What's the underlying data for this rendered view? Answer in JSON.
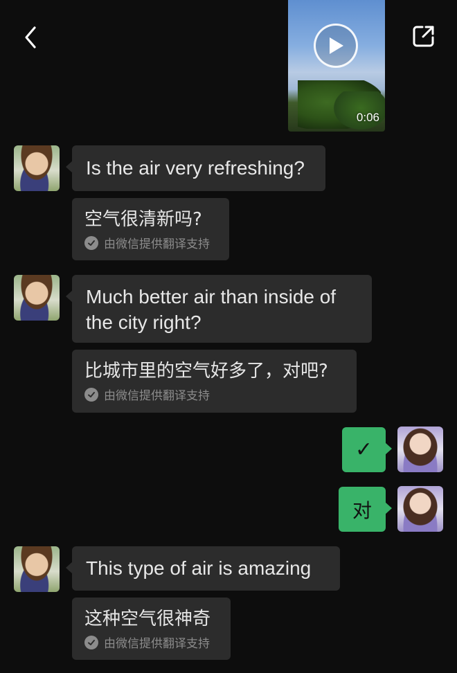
{
  "video": {
    "duration": "0:06",
    "play_icon": "play-icon"
  },
  "topbar": {
    "back_icon": "chevron-left-icon",
    "share_icon": "open-external-icon"
  },
  "translation_credit": "由微信提供翻译支持",
  "messages": [
    {
      "sender": "contact",
      "text": "Is the air very refreshing?",
      "translation": "空气很清新吗?"
    },
    {
      "sender": "contact",
      "text_lines": [
        "Much better air than inside of",
        "the city right?"
      ],
      "translation": "比城市里的空气好多了，对吧?"
    },
    {
      "sender": "me",
      "text": "✓"
    },
    {
      "sender": "me",
      "text": "对"
    },
    {
      "sender": "contact",
      "text": "This type of air is amazing",
      "translation": "这种空气很神奇"
    }
  ],
  "colors": {
    "background": "#0d0d0d",
    "bubble_incoming": "#2c2c2c",
    "bubble_outgoing": "#39b369",
    "credit_text": "#8c8c8c"
  }
}
